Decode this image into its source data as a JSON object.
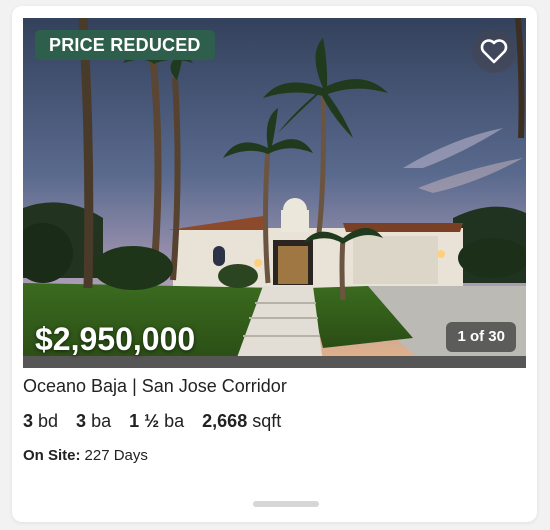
{
  "listing": {
    "badge": "PRICE REDUCED",
    "price": "$2,950,000",
    "photo_counter": "1 of 30",
    "title": "Oceano Baja | San Jose Corridor",
    "beds_value": "3",
    "beds_unit": "bd",
    "full_baths_value": "3",
    "full_baths_unit": "ba",
    "half_baths_value": "1 ½",
    "half_baths_unit": "ba",
    "sqft_value": "2,668",
    "sqft_unit": "sqft",
    "on_site_label": "On Site:",
    "on_site_value": "227 Days"
  },
  "icons": {
    "favorite": "heart-outline-icon"
  },
  "colors": {
    "badge_bg": "#2e5e4c",
    "text": "#1a1a1a"
  }
}
